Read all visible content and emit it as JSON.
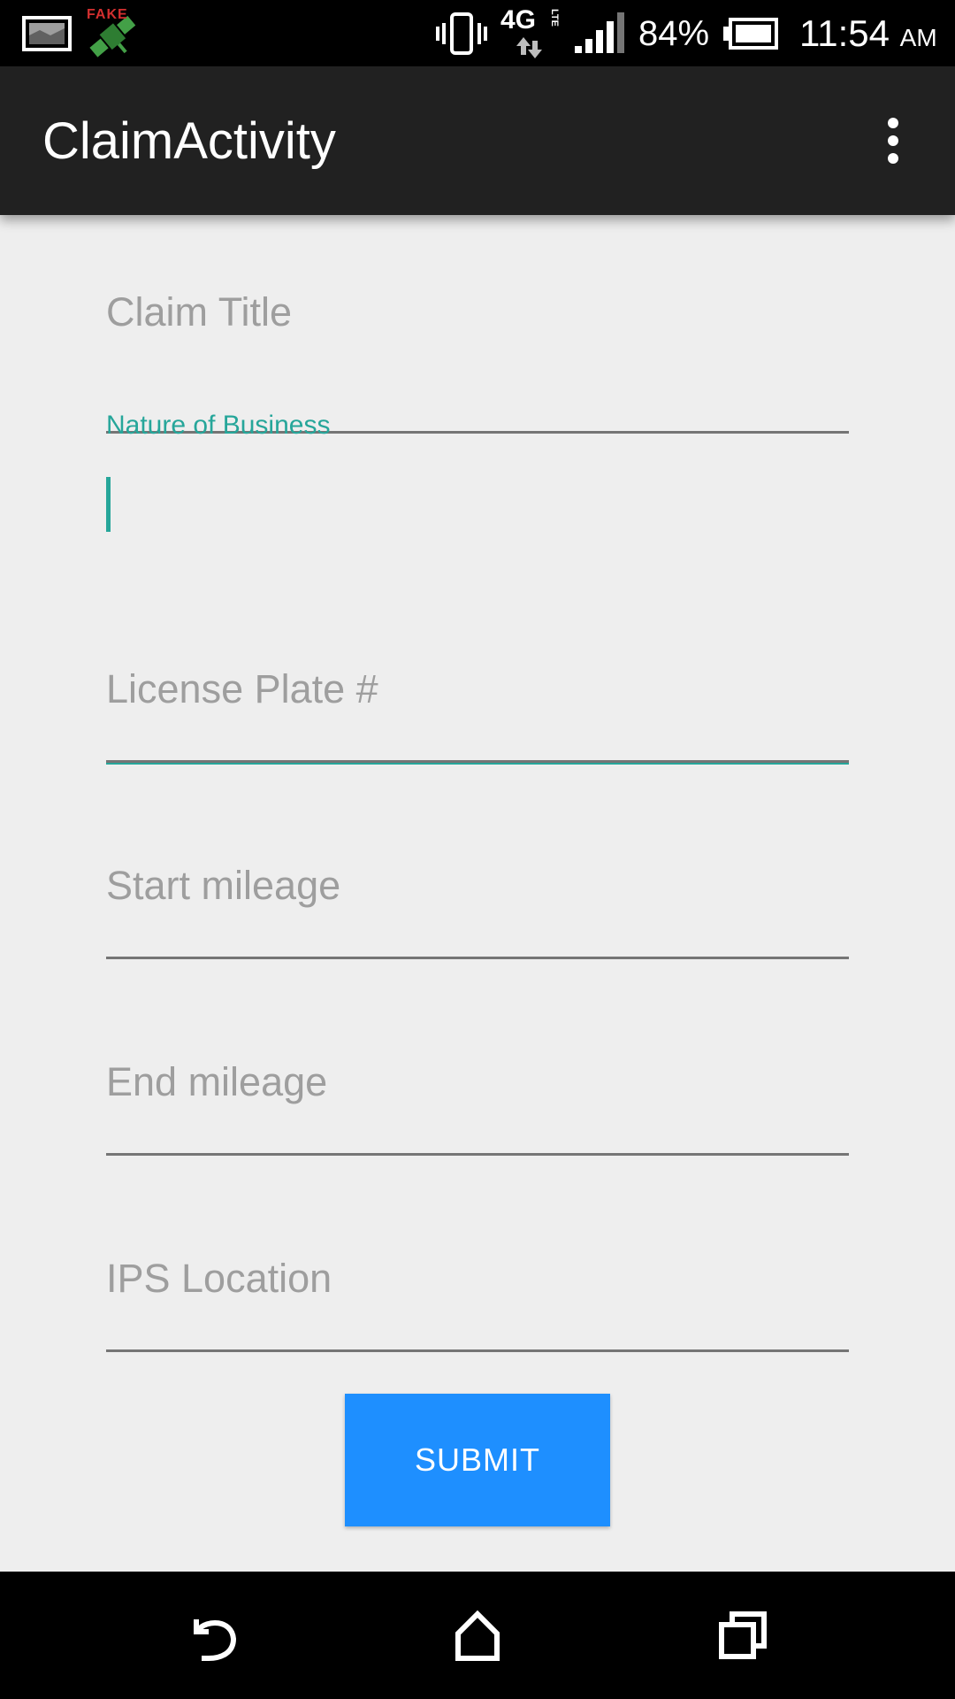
{
  "status_bar": {
    "notification_badge": "FAKE",
    "battery_percent": "84%",
    "time": "11:54",
    "time_suffix": "AM",
    "network_label": "4G",
    "network_sub_label": "LTE",
    "icons": [
      "image-notification-icon",
      "fake-gps-icon",
      "vibrate-icon",
      "network-4g-lte-icon",
      "signal-strength-icon",
      "battery-icon"
    ]
  },
  "app_bar": {
    "title": "ClaimActivity",
    "overflow_icon": "more-vert-icon"
  },
  "form": {
    "claim_title": {
      "placeholder": "Claim Title",
      "value": ""
    },
    "nature_of_business": {
      "label": "Nature of Business",
      "value": "",
      "focused": true
    },
    "license_plate": {
      "placeholder": "License Plate #",
      "value": ""
    },
    "start_mileage": {
      "placeholder": "Start mileage",
      "value": ""
    },
    "end_mileage": {
      "placeholder": "End mileage",
      "value": ""
    },
    "ips_location": {
      "placeholder": "IPS Location",
      "value": ""
    },
    "submit_label": "SUBMIT"
  },
  "nav_bar": {
    "icons": [
      "back-icon",
      "home-icon",
      "recents-icon"
    ]
  },
  "colors": {
    "accent": "#26a69a",
    "button": "#1e8fff",
    "app_bar": "#212121",
    "background": "#eeeeee"
  }
}
